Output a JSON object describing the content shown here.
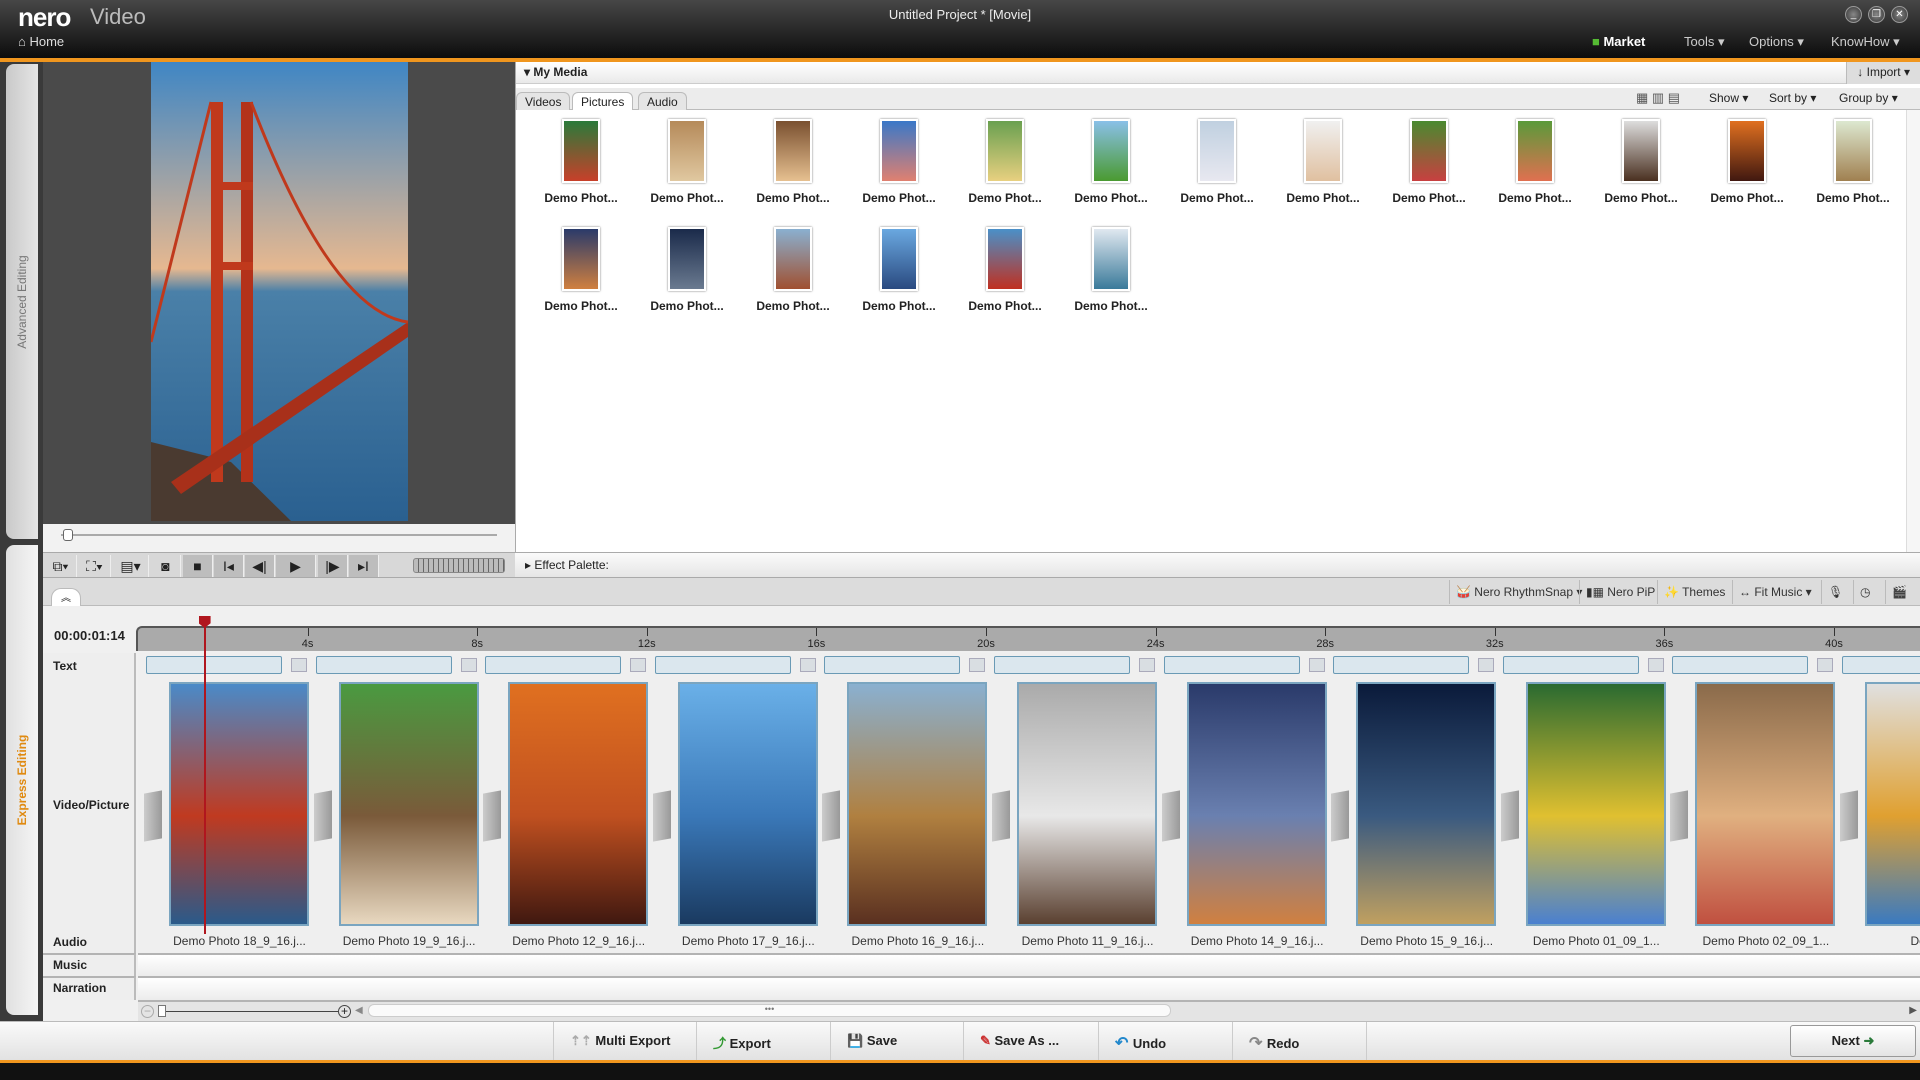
{
  "app": {
    "logo": "nero",
    "product": "Video",
    "title": "Untitled Project * [Movie]",
    "home": "Home"
  },
  "menu": [
    {
      "label": "Market",
      "bold": true
    },
    {
      "label": "Tools ▾"
    },
    {
      "label": "Options ▾"
    },
    {
      "label": "KnowHow ▾"
    }
  ],
  "window_controls": [
    "_",
    "❐",
    "✕"
  ],
  "side_tabs": {
    "advanced": "Advanced Editing",
    "express": "Express Editing"
  },
  "accent": "#f0961e",
  "media": {
    "title": "▾ My Media",
    "import": "↓ Import ▾",
    "tabs": [
      "Videos",
      "Pictures",
      "Audio"
    ],
    "active_tab": "Pictures",
    "controls": {
      "show": "Show ▾",
      "sort": "Sort by ▾",
      "group": "Group by ▾"
    },
    "items": [
      {
        "name": "Demo Phot...",
        "colors": [
          "#2a7a3a",
          "#c8402a"
        ]
      },
      {
        "name": "Demo Phot...",
        "colors": [
          "#b58a5a",
          "#e0c8a0"
        ]
      },
      {
        "name": "Demo Phot...",
        "colors": [
          "#7a5030",
          "#e6c090"
        ]
      },
      {
        "name": "Demo Phot...",
        "colors": [
          "#3a78c8",
          "#e08070"
        ]
      },
      {
        "name": "Demo Phot...",
        "colors": [
          "#6aa050",
          "#e8d080"
        ]
      },
      {
        "name": "Demo Phot...",
        "colors": [
          "#8ac0e8",
          "#4a9a30"
        ]
      },
      {
        "name": "Demo Phot...",
        "colors": [
          "#c0d0e0",
          "#e8e8f0"
        ]
      },
      {
        "name": "Demo Phot...",
        "colors": [
          "#f0f0f0",
          "#e0c0a0"
        ]
      },
      {
        "name": "Demo Phot...",
        "colors": [
          "#4a8a30",
          "#c84040"
        ]
      },
      {
        "name": "Demo Phot...",
        "colors": [
          "#5a9a3a",
          "#e07050"
        ]
      },
      {
        "name": "Demo Phot...",
        "colors": [
          "#dddddd",
          "#4a3020"
        ]
      },
      {
        "name": "Demo Phot...",
        "colors": [
          "#e07020",
          "#401810"
        ]
      },
      {
        "name": "Demo Phot...",
        "colors": [
          "#dde8d0",
          "#a08050"
        ]
      },
      {
        "name": "Demo Phot...",
        "colors": [
          "#2a3a6a",
          "#d08040"
        ]
      },
      {
        "name": "Demo Phot...",
        "colors": [
          "#1a2a4a",
          "#6a7a90"
        ]
      },
      {
        "name": "Demo Phot...",
        "colors": [
          "#8ab0d0",
          "#a05030"
        ]
      },
      {
        "name": "Demo Phot...",
        "colors": [
          "#6aa8e0",
          "#2a4a80"
        ]
      },
      {
        "name": "Demo Phot...",
        "colors": [
          "#4a90c8",
          "#c03020"
        ]
      },
      {
        "name": "Demo Phot...",
        "colors": [
          "#e0e8f0",
          "#3a7a9a"
        ]
      }
    ]
  },
  "effect_palette": "Effect Palette:",
  "tools": [
    "Nero RhythmSnap ▾",
    "Nero PiP",
    "Themes",
    "Fit Music ▾"
  ],
  "timeline": {
    "timecode": "00:00:01:14",
    "ticks": [
      "4s",
      "8s",
      "12s",
      "16s",
      "20s",
      "24s",
      "28s",
      "32s",
      "36s",
      "40s"
    ],
    "tracks": {
      "text": "Text",
      "video": "Video/Picture",
      "audio": "Audio",
      "music": "Music",
      "narration": "Narration"
    },
    "clips": [
      {
        "name": "Demo Photo 18_9_16.j...",
        "colors": [
          "#4a8ac8",
          "#c03a20",
          "#2a5a8a"
        ]
      },
      {
        "name": "Demo Photo 19_9_16.j...",
        "colors": [
          "#4a9a40",
          "#7a5a3a",
          "#e8d8c0"
        ]
      },
      {
        "name": "Demo Photo 12_9_16.j...",
        "colors": [
          "#e07020",
          "#c05020",
          "#401810"
        ]
      },
      {
        "name": "Demo Photo 17_9_16.j...",
        "colors": [
          "#6ab0e8",
          "#3a78b8",
          "#1a3a60"
        ]
      },
      {
        "name": "Demo Photo 16_9_16.j...",
        "colors": [
          "#8ab0d0",
          "#b08040",
          "#5a3020"
        ]
      },
      {
        "name": "Demo Photo 11_9_16.j...",
        "colors": [
          "#aaaaaa",
          "#e8e8e8",
          "#5a4030"
        ]
      },
      {
        "name": "Demo Photo 14_9_16.j...",
        "colors": [
          "#2a3a6a",
          "#6a80b0",
          "#d08040"
        ]
      },
      {
        "name": "Demo Photo 15_9_16.j...",
        "colors": [
          "#0a1a3a",
          "#3a5a80",
          "#c0a060"
        ]
      },
      {
        "name": "Demo Photo 01_09_1...",
        "colors": [
          "#2a6a30",
          "#e0c030",
          "#4a80d0"
        ]
      },
      {
        "name": "Demo Photo 02_09_1...",
        "colors": [
          "#8a6a4a",
          "#e0b080",
          "#c05040"
        ]
      },
      {
        "name": "Demo Ph",
        "colors": [
          "#e0e0e0",
          "#e0a030",
          "#3a7ac0"
        ]
      }
    ],
    "playhead_seconds": 1.5
  },
  "bottom": {
    "multi_export": "Multi Export",
    "export": "Export",
    "save": "Save",
    "save_as": "Save As ...",
    "undo": "Undo",
    "redo": "Redo",
    "next": "Next"
  }
}
